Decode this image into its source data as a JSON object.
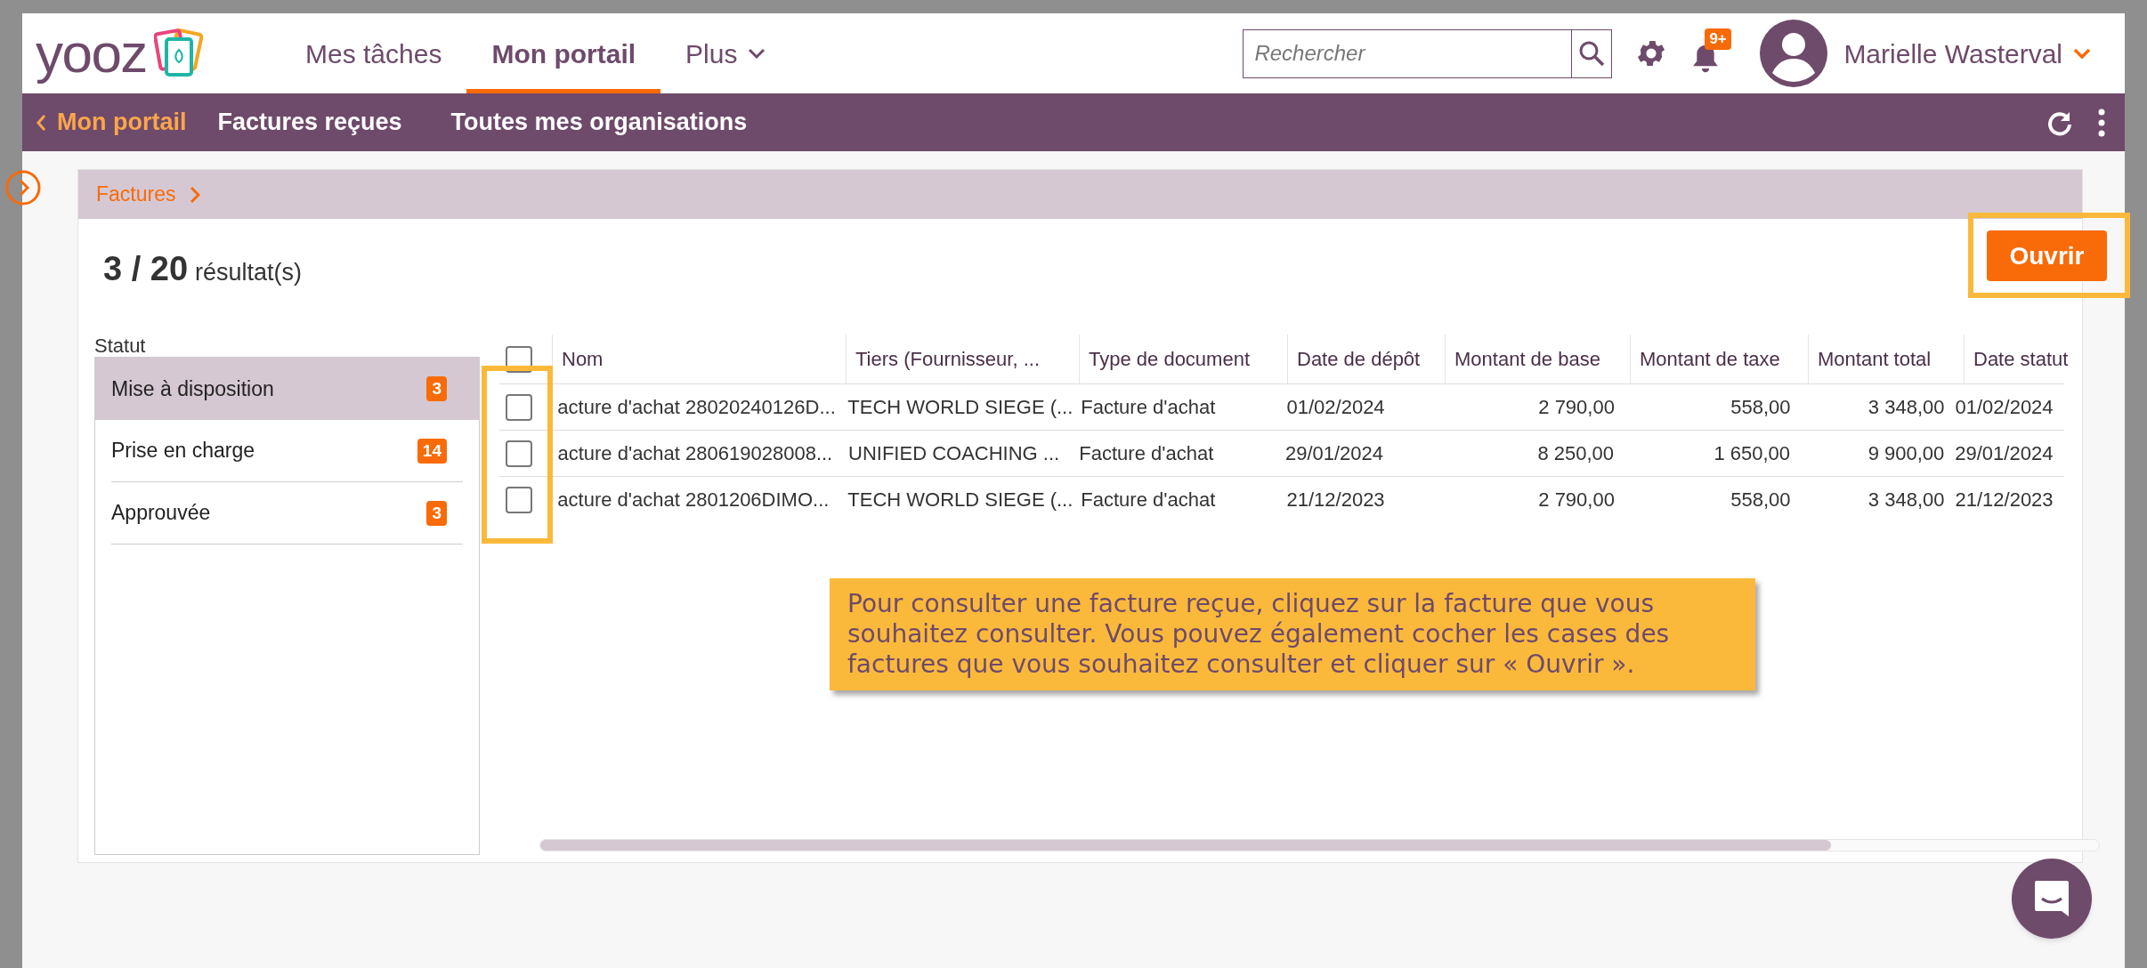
{
  "header": {
    "logo": "yooz",
    "tabs": [
      {
        "label": "Mes tâches",
        "selected": false,
        "dropdown": false
      },
      {
        "label": "Mon portail",
        "selected": true,
        "dropdown": false
      },
      {
        "label": "Plus",
        "selected": false,
        "dropdown": true
      }
    ],
    "search": {
      "placeholder": "Rechercher"
    },
    "notification_badge": "9+",
    "user": "Marielle Wasterval"
  },
  "subnav": {
    "back": "Mon portail",
    "items": [
      "Factures reçues",
      "Toutes mes organisations"
    ]
  },
  "breadcrumb": "Factures",
  "results": {
    "count": "3 / 20",
    "label": "résultat(s)"
  },
  "open_button": "Ouvrir",
  "status_filter": {
    "title": "Statut",
    "items": [
      {
        "label": "Mise à disposition",
        "count": "3",
        "selected": true
      },
      {
        "label": "Prise en charge",
        "count": "14",
        "selected": false
      },
      {
        "label": "Approuvée",
        "count": "3",
        "selected": false
      }
    ]
  },
  "table": {
    "select_all_checked": false,
    "columns": [
      "Nom",
      "Tiers (Fournisseur, ...",
      "Type de document",
      "Date de dépôt",
      "Montant de base",
      "Montant de taxe",
      "Montant total",
      "Date statut"
    ],
    "rows": [
      {
        "checked": false,
        "cells": [
          "acture d'achat 28020240126D...",
          "TECH WORLD SIEGE (...",
          "Facture d'achat",
          "01/02/2024",
          "2 790,00",
          "558,00",
          "3 348,00",
          "01/02/2024"
        ]
      },
      {
        "checked": false,
        "cells": [
          "acture d'achat 280619028008...",
          "UNIFIED COACHING ...",
          "Facture d'achat",
          "29/01/2024",
          "8 250,00",
          "1 650,00",
          "9 900,00",
          "29/01/2024"
        ]
      },
      {
        "checked": false,
        "cells": [
          "acture d'achat 2801206DIMO...",
          "TECH WORLD SIEGE (...",
          "Facture d'achat",
          "21/12/2023",
          "2 790,00",
          "558,00",
          "3 348,00",
          "21/12/2023"
        ]
      }
    ]
  },
  "callout": "Pour consulter une facture reçue, cliquez sur la facture que vous souhaitez consulter. Vous pouvez également cocher les cases des factures que vous souhaitez consulter et cliquer sur « Ouvrir »."
}
